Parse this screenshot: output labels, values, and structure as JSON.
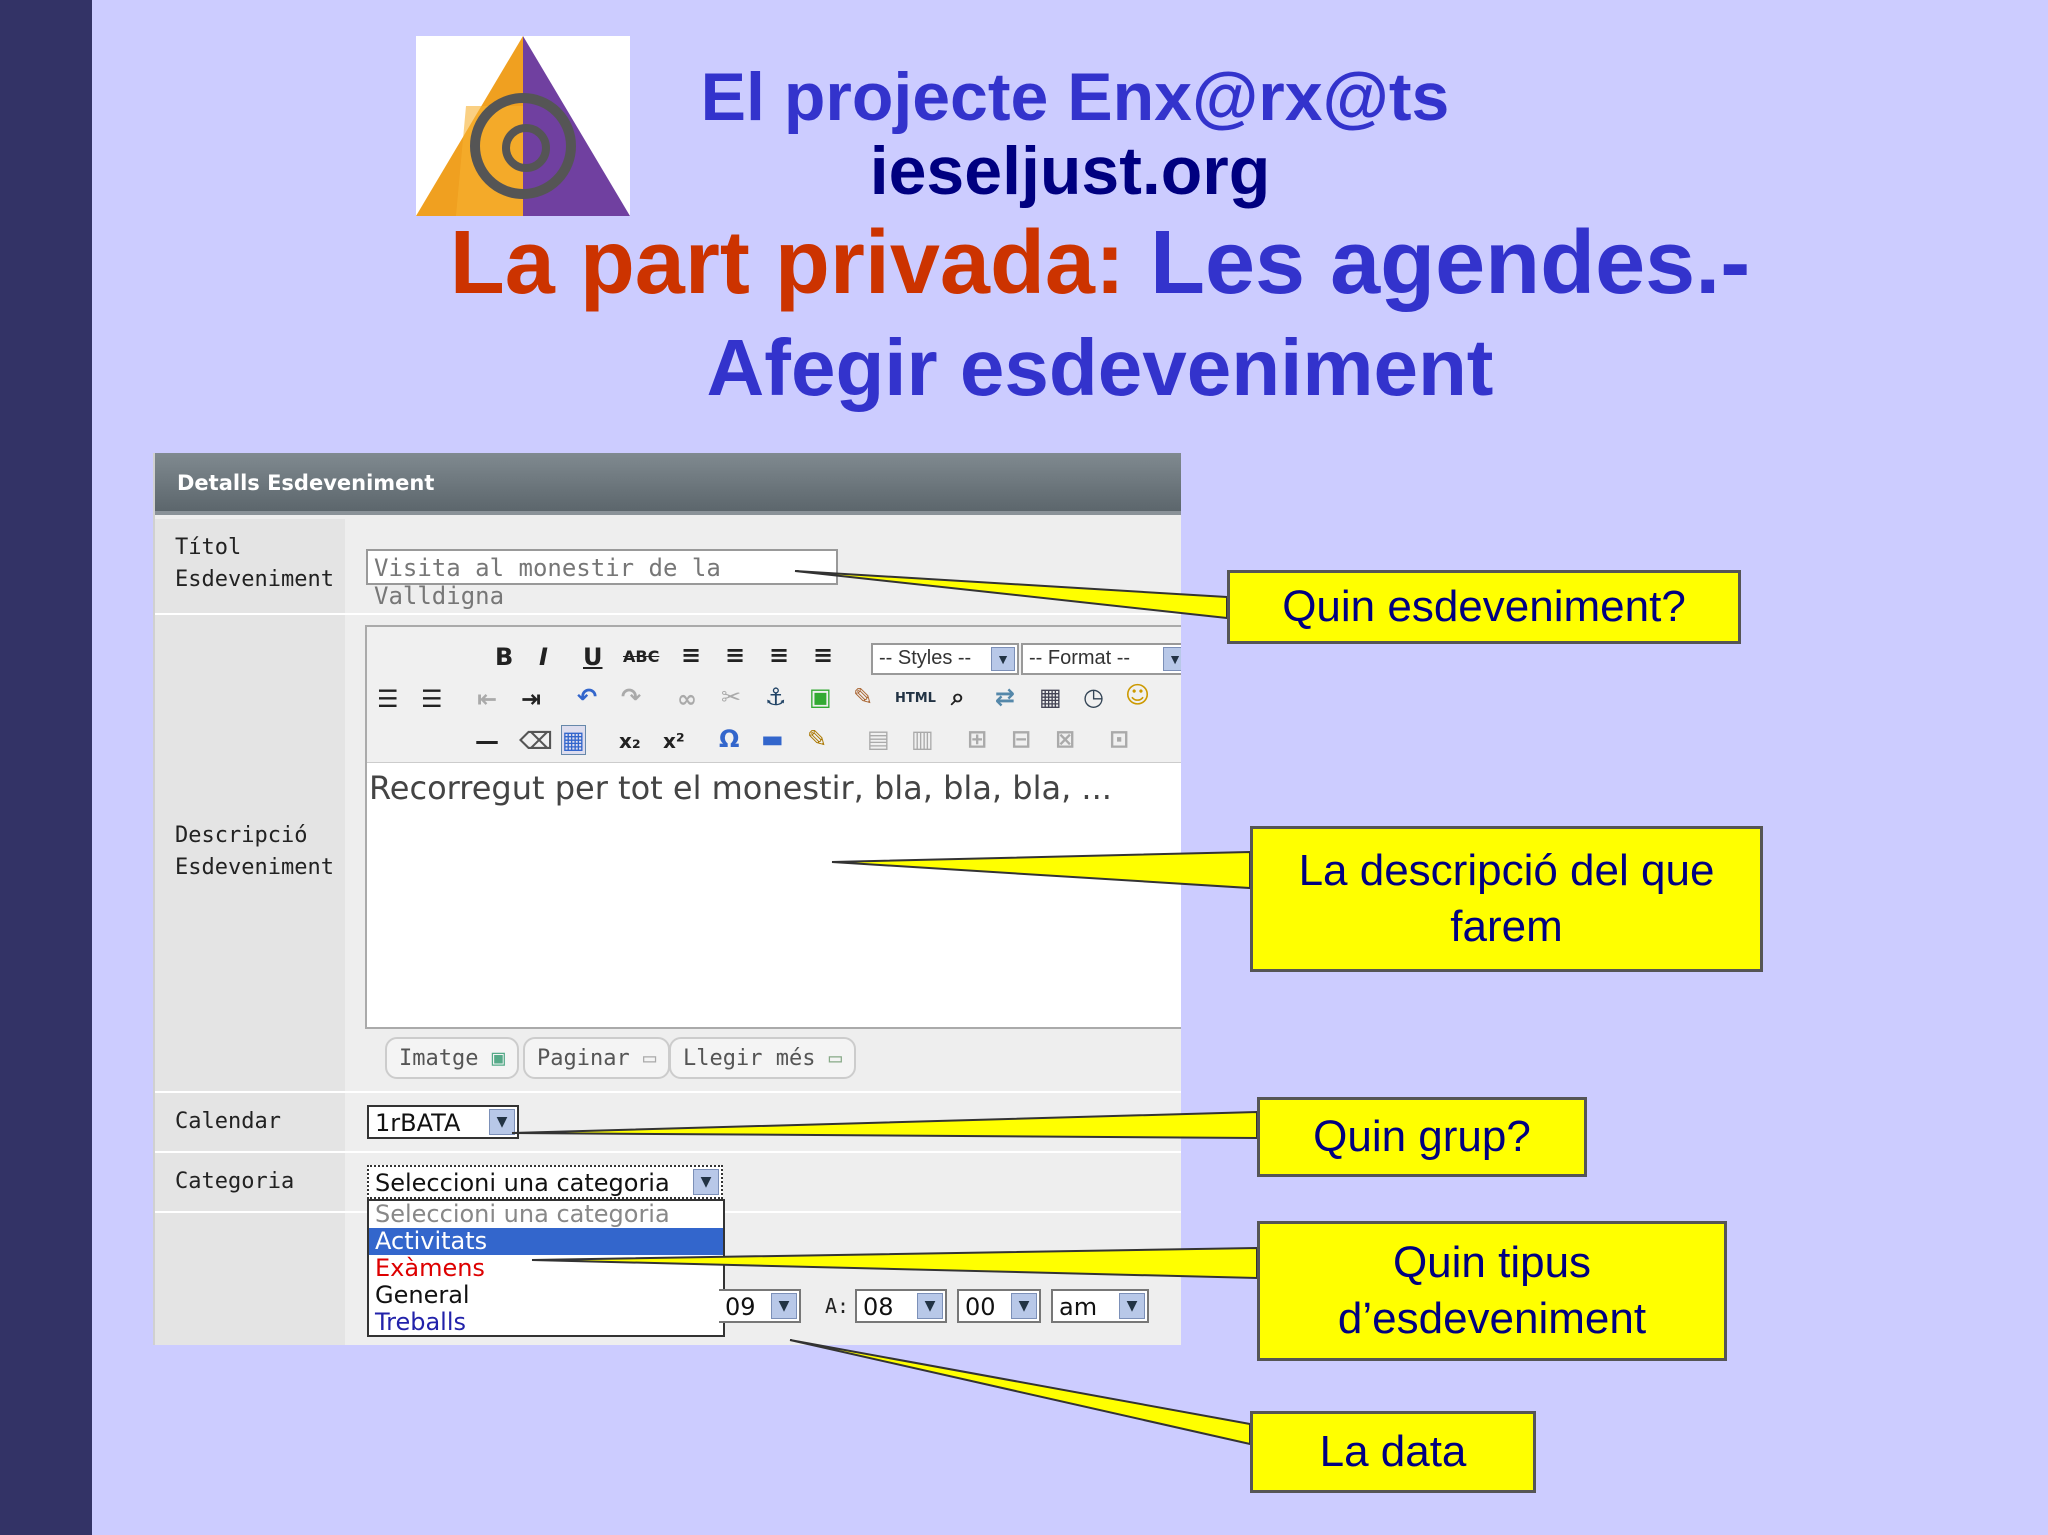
{
  "title": {
    "line1": "El projecte Enx@rx@ts",
    "line2": "ieseljust.org",
    "line3_red": "La part privada:",
    "line3_blue": "Les agendes.-",
    "line4": "Afegir esdeveniment"
  },
  "logo": {
    "icon": "at-triangle-logo-icon"
  },
  "panel": {
    "header": "Detalls Esdeveniment",
    "title_label_1": "Títol",
    "title_label_2": "Esdeveniment",
    "title_value": "Visita al monestir de la Valldigna",
    "desc_label_1": "Descripció",
    "desc_label_2": "Esdeveniment",
    "toolbar": {
      "bold": "B",
      "italic": "I",
      "underline": "U",
      "strike": "ABC",
      "styles": "-- Styles --",
      "format": "-- Format --",
      "html": "HTML",
      "omega": "Ω",
      "subscript": "x₂",
      "superscript": "x²"
    },
    "desc_value": "Recorregut per tot el monestir, bla, bla, bla, ...",
    "buttons": {
      "image": "Imatge",
      "page": "Paginar",
      "readmore": "Llegir més"
    },
    "calendar_label": "Calendar",
    "calendar_value": "1rBATA",
    "category_label": "Categoria",
    "category_value": "Seleccioni una categoria",
    "category_options": [
      "Seleccioni una categoria",
      "Activitats",
      "Exàmens",
      "General",
      "Treballs"
    ],
    "date_day": "09",
    "time_label": "A:",
    "time_hour": "08",
    "time_min": "00",
    "time_ampm": "am"
  },
  "callouts": {
    "event": "Quin esdeveniment?",
    "desc_1": "La descripció del que",
    "desc_2": "farem",
    "group": "Quin grup?",
    "type_1": "Quin tipus",
    "type_2": "d’esdeveniment",
    "date": "La data"
  },
  "colors": {
    "background": "#ccccff",
    "sidebar": "#333366",
    "title_blue": "#3333cc",
    "title_dark": "#000080",
    "title_red": "#cc3300",
    "callout_fill": "#ffff00",
    "selected_option": "#3366cc",
    "exams_red": "#dd0000",
    "works_blue": "#2222aa"
  }
}
